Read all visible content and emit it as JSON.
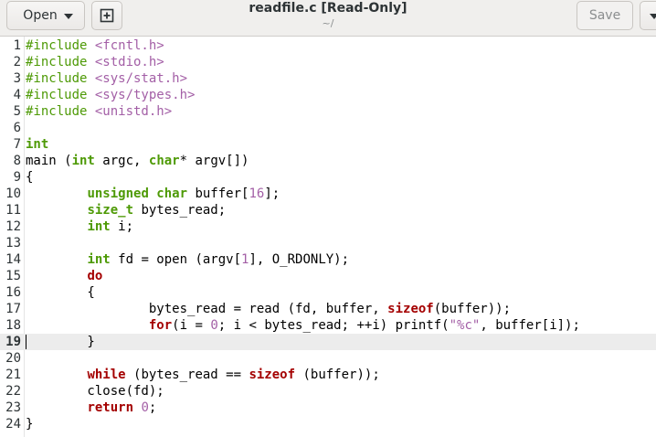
{
  "header": {
    "open_label": "Open",
    "title": "readfile.c [Read-Only]",
    "subtitle": "~/",
    "save_label": "Save",
    "new_tab_icon": "new-tab-icon"
  },
  "editor": {
    "current_line": 19,
    "lines": [
      {
        "n": "1",
        "tokens": [
          [
            "pp",
            "#include "
          ],
          [
            "hdr",
            "<fcntl.h>"
          ]
        ]
      },
      {
        "n": "2",
        "tokens": [
          [
            "pp",
            "#include "
          ],
          [
            "hdr",
            "<stdio.h>"
          ]
        ]
      },
      {
        "n": "3",
        "tokens": [
          [
            "pp",
            "#include "
          ],
          [
            "hdr",
            "<sys/stat.h>"
          ]
        ]
      },
      {
        "n": "4",
        "tokens": [
          [
            "pp",
            "#include "
          ],
          [
            "hdr",
            "<sys/types.h>"
          ]
        ]
      },
      {
        "n": "5",
        "tokens": [
          [
            "pp",
            "#include "
          ],
          [
            "hdr",
            "<unistd.h>"
          ]
        ]
      },
      {
        "n": "6",
        "tokens": []
      },
      {
        "n": "7",
        "tokens": [
          [
            "type",
            "int"
          ]
        ]
      },
      {
        "n": "8",
        "tokens": [
          [
            "plain",
            "main ("
          ],
          [
            "type",
            "int"
          ],
          [
            "plain",
            " argc, "
          ],
          [
            "type",
            "char"
          ],
          [
            "plain",
            "* argv[])"
          ]
        ]
      },
      {
        "n": "9",
        "tokens": [
          [
            "plain",
            "{"
          ]
        ]
      },
      {
        "n": "10",
        "tokens": [
          [
            "plain",
            "        "
          ],
          [
            "type",
            "unsigned char"
          ],
          [
            "plain",
            " buffer["
          ],
          [
            "num",
            "16"
          ],
          [
            "plain",
            "];"
          ]
        ]
      },
      {
        "n": "11",
        "tokens": [
          [
            "plain",
            "        "
          ],
          [
            "type",
            "size_t"
          ],
          [
            "plain",
            " bytes_read;"
          ]
        ]
      },
      {
        "n": "12",
        "tokens": [
          [
            "plain",
            "        "
          ],
          [
            "type",
            "int"
          ],
          [
            "plain",
            " i;"
          ]
        ]
      },
      {
        "n": "13",
        "tokens": []
      },
      {
        "n": "14",
        "tokens": [
          [
            "plain",
            "        "
          ],
          [
            "type",
            "int"
          ],
          [
            "plain",
            " fd = open (argv["
          ],
          [
            "num",
            "1"
          ],
          [
            "plain",
            "], O_RDONLY);"
          ]
        ]
      },
      {
        "n": "15",
        "tokens": [
          [
            "plain",
            "        "
          ],
          [
            "kw",
            "do"
          ]
        ]
      },
      {
        "n": "16",
        "tokens": [
          [
            "plain",
            "        {"
          ]
        ]
      },
      {
        "n": "17",
        "tokens": [
          [
            "plain",
            "                bytes_read = read (fd, buffer, "
          ],
          [
            "kw",
            "sizeof"
          ],
          [
            "plain",
            "(buffer));"
          ]
        ]
      },
      {
        "n": "18",
        "tokens": [
          [
            "plain",
            "                "
          ],
          [
            "kw",
            "for"
          ],
          [
            "plain",
            "(i = "
          ],
          [
            "num",
            "0"
          ],
          [
            "plain",
            "; i < bytes_read; ++i) printf("
          ],
          [
            "str",
            "\"%c\""
          ],
          [
            "plain",
            ", buffer[i]);"
          ]
        ]
      },
      {
        "n": "19",
        "tokens": [
          [
            "plain",
            "        }"
          ]
        ]
      },
      {
        "n": "20",
        "tokens": []
      },
      {
        "n": "21",
        "tokens": [
          [
            "plain",
            "        "
          ],
          [
            "kw",
            "while"
          ],
          [
            "plain",
            " (bytes_read == "
          ],
          [
            "kw",
            "sizeof"
          ],
          [
            "plain",
            " (buffer));"
          ]
        ]
      },
      {
        "n": "22",
        "tokens": [
          [
            "plain",
            "        close(fd);"
          ]
        ]
      },
      {
        "n": "23",
        "tokens": [
          [
            "plain",
            "        "
          ],
          [
            "kw",
            "return"
          ],
          [
            "plain",
            " "
          ],
          [
            "num",
            "0"
          ],
          [
            "plain",
            ";"
          ]
        ]
      },
      {
        "n": "24",
        "tokens": [
          [
            "plain",
            "}"
          ]
        ]
      }
    ]
  }
}
